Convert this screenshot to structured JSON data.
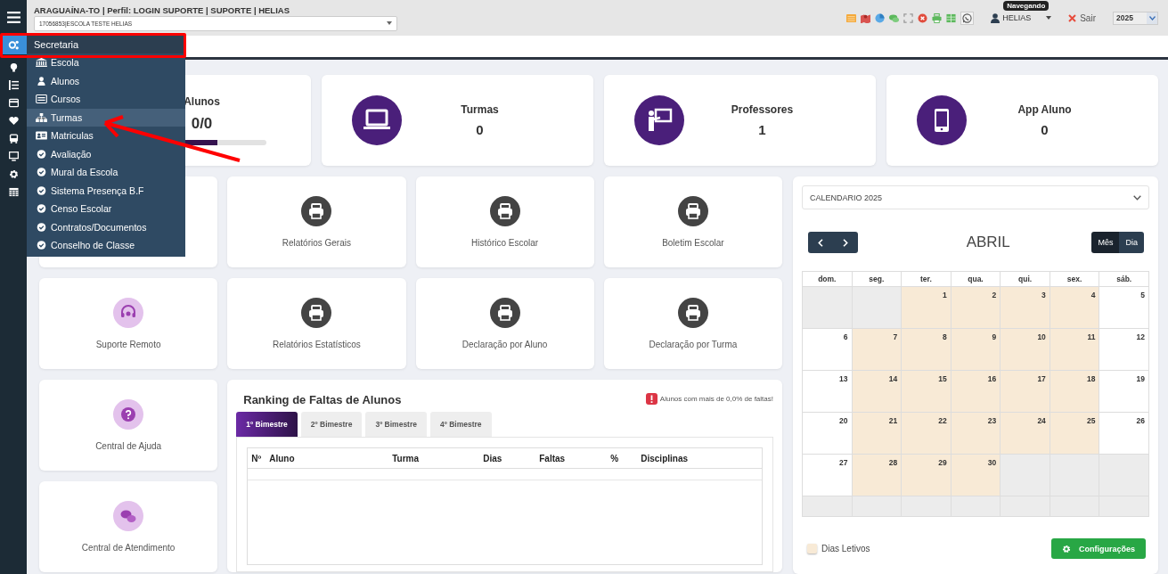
{
  "header": {
    "title": "ARAGUAÍNA-TO | Perfil: LOGIN SUPORTE | SUPORTE | HELIAS",
    "school_select": "17056853|ESCOLA TESTE HELIAS",
    "tooltip": "Navegando",
    "user": "HELIAS",
    "logout": "Sair",
    "year": "2025"
  },
  "menu": {
    "title": "Secretaria",
    "items": [
      {
        "label": "Escola",
        "selected": false
      },
      {
        "label": "Alunos",
        "selected": false
      },
      {
        "label": "Cursos",
        "selected": false
      },
      {
        "label": "Turmas",
        "selected": true
      },
      {
        "label": "Matriculas",
        "selected": false
      },
      {
        "label": "Avaliação",
        "selected": false
      },
      {
        "label": "Mural da Escola",
        "selected": false
      },
      {
        "label": "Sistema Presença B.F",
        "selected": false
      },
      {
        "label": "Censo Escolar",
        "selected": false
      },
      {
        "label": "Contratos/Documentos",
        "selected": false
      },
      {
        "label": "Conselho de Classe",
        "selected": false
      }
    ]
  },
  "stats": [
    {
      "kind": "progress",
      "label": "Alunos",
      "value": "0/0",
      "level": 0.62
    },
    {
      "kind": "icon",
      "label": "Turmas",
      "value": "0"
    },
    {
      "kind": "icon",
      "label": "Professores",
      "value": "1"
    },
    {
      "kind": "icon",
      "label": "App Aluno",
      "value": "0"
    }
  ],
  "shortcuts": [
    {
      "kind": "report",
      "label": "Relatórios Gerais"
    },
    {
      "kind": "report",
      "label": "Histórico Escolar"
    },
    {
      "kind": "report",
      "label": "Boletim Escolar"
    },
    {
      "kind": "service",
      "label": "Suporte Remoto"
    },
    {
      "kind": "report",
      "label": "Relatórios Estatísticos"
    },
    {
      "kind": "report",
      "label": "Declaração por Aluno"
    },
    {
      "kind": "report",
      "label": "Declaração por Turma"
    },
    {
      "kind": "service",
      "label": "Central de Ajuda"
    },
    {
      "kind": "service",
      "label": "Central de Atendimento"
    }
  ],
  "ranking": {
    "title": "Ranking de Faltas de Alunos",
    "alert": "Alunos com mais de 0,0% de faltas!",
    "tabs": [
      {
        "label": "1º Bimestre",
        "selected": true
      },
      {
        "label": "2º Bimestre",
        "selected": false
      },
      {
        "label": "3º Bimestre",
        "selected": false
      },
      {
        "label": "4º Bimestre",
        "selected": false
      }
    ],
    "columns": [
      "Nº",
      "Aluno",
      "Turma",
      "Dias",
      "Faltas",
      "%",
      "Disciplinas"
    ]
  },
  "calendar": {
    "select": "CALENDARIO 2025",
    "month": "ABRIL",
    "views": [
      {
        "label": "Mês",
        "selected": true
      },
      {
        "label": "Dia",
        "selected": false
      }
    ],
    "weekdays": [
      "dom.",
      "seg.",
      "ter.",
      "qua.",
      "qui.",
      "sex.",
      "sáb."
    ],
    "weeks": [
      [
        {
          "kind": "other"
        },
        {
          "kind": "other"
        },
        {
          "kind": "letivo",
          "day": "1"
        },
        {
          "kind": "letivo",
          "day": "2"
        },
        {
          "kind": "letivo",
          "day": "3"
        },
        {
          "kind": "letivo",
          "day": "4"
        },
        {
          "kind": "normal",
          "day": "5"
        }
      ],
      [
        {
          "kind": "normal",
          "day": "6"
        },
        {
          "kind": "letivo",
          "day": "7"
        },
        {
          "kind": "letivo",
          "day": "8"
        },
        {
          "kind": "letivo",
          "day": "9"
        },
        {
          "kind": "letivo",
          "day": "10"
        },
        {
          "kind": "letivo",
          "day": "11"
        },
        {
          "kind": "normal",
          "day": "12"
        }
      ],
      [
        {
          "kind": "normal",
          "day": "13"
        },
        {
          "kind": "letivo",
          "day": "14"
        },
        {
          "kind": "letivo",
          "day": "15"
        },
        {
          "kind": "letivo",
          "day": "16"
        },
        {
          "kind": "letivo",
          "day": "17"
        },
        {
          "kind": "letivo",
          "day": "18"
        },
        {
          "kind": "normal",
          "day": "19"
        }
      ],
      [
        {
          "kind": "normal",
          "day": "20"
        },
        {
          "kind": "letivo",
          "day": "21"
        },
        {
          "kind": "letivo",
          "day": "22"
        },
        {
          "kind": "letivo",
          "day": "23"
        },
        {
          "kind": "letivo",
          "day": "24"
        },
        {
          "kind": "letivo",
          "day": "25"
        },
        {
          "kind": "normal",
          "day": "26"
        }
      ],
      [
        {
          "kind": "normal",
          "day": "27"
        },
        {
          "kind": "letivo",
          "day": "28"
        },
        {
          "kind": "letivo",
          "day": "29"
        },
        {
          "kind": "letivo",
          "day": "30"
        },
        {
          "kind": "other"
        },
        {
          "kind": "other"
        },
        {
          "kind": "other"
        }
      ],
      [
        {
          "kind": "other"
        },
        {
          "kind": "other"
        },
        {
          "kind": "other"
        },
        {
          "kind": "other"
        },
        {
          "kind": "other"
        },
        {
          "kind": "other"
        },
        {
          "kind": "other"
        }
      ]
    ],
    "legend": "Dias Letivos",
    "settings_button": "Configurações"
  }
}
